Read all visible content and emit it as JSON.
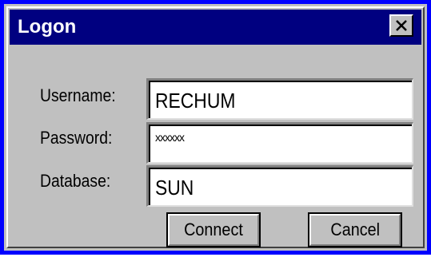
{
  "dialog": {
    "title": "Logon",
    "close_icon": "close-x-icon"
  },
  "form": {
    "username_label": "Username:",
    "username_value": "RECHUM",
    "password_label": "Password:",
    "password_value": "xxxxxx",
    "database_label": "Database:",
    "database_value": "SUN"
  },
  "buttons": {
    "connect_label": "Connect",
    "cancel_label": "Cancel"
  },
  "colors": {
    "titlebar": "#000080",
    "frame": "#0000ff",
    "face": "#c0c0c0"
  }
}
